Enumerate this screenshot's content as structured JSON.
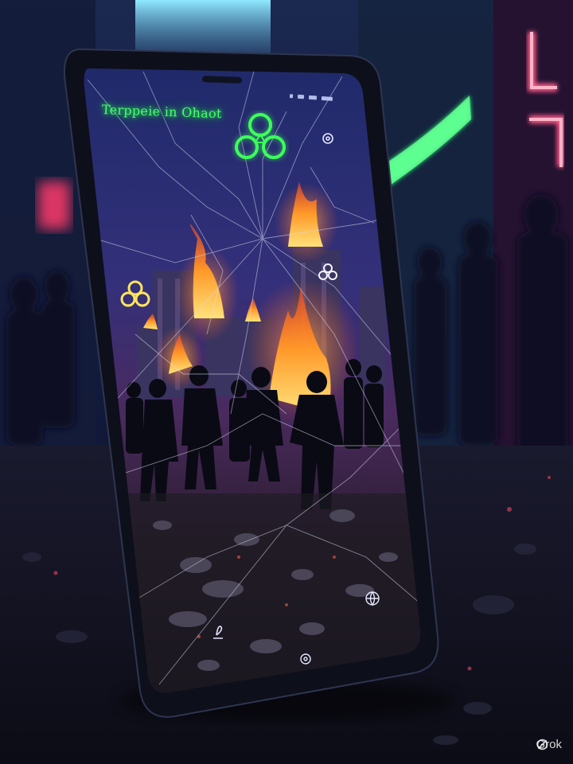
{
  "screen_title": "Terppeie in Ohaot",
  "watermark": "Grok",
  "icons": [
    "trefoil-logo-icon",
    "trefoil-small-icon",
    "settings-icon",
    "trefoil-tower-icon",
    "globe-icon",
    "pen-icon",
    "home-icon"
  ],
  "colors": {
    "neon_green": "#46ff6a",
    "neon_red": "#ff3a6a",
    "fire": "#ff9a2a",
    "sky": "#2a2b6a"
  }
}
